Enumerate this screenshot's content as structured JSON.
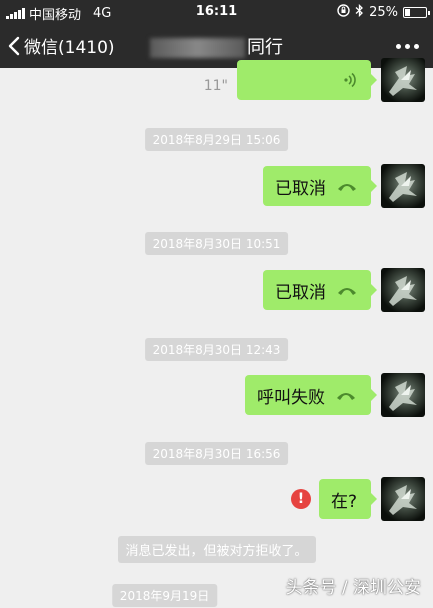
{
  "status_bar": {
    "carrier": "中国移动",
    "network": "4G",
    "time": "16:11",
    "battery": "25%",
    "battery_level": 0.25
  },
  "nav": {
    "back_label": "微信(1410)",
    "title_suffix": "同行"
  },
  "messages": {
    "voice_duration": "11\"",
    "ts1": "2018年8月29日 15:06",
    "msg1": "已取消",
    "ts2": "2018年8月30日 10:51",
    "msg2": "已取消",
    "ts3": "2018年8月30日 12:43",
    "msg3": "呼叫失败",
    "ts4": "2018年8月30日 16:56",
    "msg4": "在?",
    "error_mark": "!",
    "notice": "消息已发出，但被对方拒收了。",
    "ts5": "2018年9月19日"
  },
  "watermark": "头条号 / 深圳公安",
  "colors": {
    "bubble": "#9feb6a",
    "bar": "#2b2b2b",
    "error": "#e64340",
    "background": "#efefef"
  }
}
